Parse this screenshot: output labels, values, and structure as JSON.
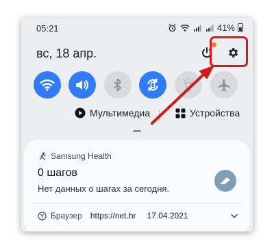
{
  "status_bar": {
    "time": "05:21",
    "battery_percent": "41%",
    "icons": [
      "alarm-icon",
      "wifi-icon",
      "signal-icon",
      "signal-icon",
      "battery-icon"
    ]
  },
  "header": {
    "date": "вс, 18 апр.",
    "power_icon": "power-icon",
    "settings_icon": "gear-icon",
    "notification_dot_color": "#f07a2a"
  },
  "quick_toggles": [
    {
      "name": "wifi",
      "icon": "wifi-icon",
      "state": "on"
    },
    {
      "name": "sound",
      "icon": "volume-icon",
      "state": "on"
    },
    {
      "name": "bluetooth",
      "icon": "bluetooth-icon",
      "state": "off"
    },
    {
      "name": "auto-rotate",
      "icon": "rotate-icon",
      "state": "on"
    },
    {
      "name": "flashlight",
      "icon": "flashlight-icon",
      "state": "off"
    },
    {
      "name": "airplane",
      "icon": "airplane-icon",
      "state": "off"
    }
  ],
  "media_row": {
    "media_label": "Мультимедиа",
    "devices_label": "Устройства"
  },
  "notification": {
    "app_name": "Samsung Health",
    "title": "0 шагов",
    "message": "Нет данных о шагах за сегодня."
  },
  "browser_notification": {
    "app_name": "Браузер",
    "url": "https://net.hr",
    "date": "17.04.2021"
  },
  "colors": {
    "accent": "#2f7cf6",
    "highlight": "#d11b1b",
    "panel_bg": "#eceef1"
  }
}
